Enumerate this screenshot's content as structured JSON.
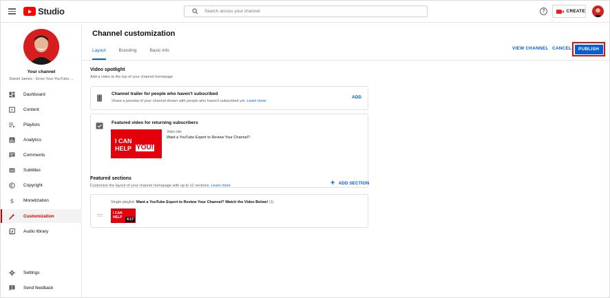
{
  "app": {
    "logo_text": "Studio"
  },
  "search": {
    "placeholder": "Search across your channel"
  },
  "header": {
    "help": "?",
    "create_label": "CREATE"
  },
  "sidebar": {
    "your_channel": "Your channel",
    "channel_name": "Daniel James - Grow Your YouTube ...",
    "items": [
      {
        "label": "Dashboard",
        "icon": "dashboard-icon"
      },
      {
        "label": "Content",
        "icon": "content-icon"
      },
      {
        "label": "Playlists",
        "icon": "playlists-icon"
      },
      {
        "label": "Analytics",
        "icon": "analytics-icon"
      },
      {
        "label": "Comments",
        "icon": "comments-icon"
      },
      {
        "label": "Subtitles",
        "icon": "subtitles-icon"
      },
      {
        "label": "Copyright",
        "icon": "copyright-icon"
      },
      {
        "label": "Monetization",
        "icon": "monetization-icon"
      },
      {
        "label": "Customization",
        "icon": "customization-icon",
        "active": true
      },
      {
        "label": "Audio library",
        "icon": "audio-library-icon"
      }
    ],
    "bottom_items": [
      {
        "label": "Settings",
        "icon": "settings-icon"
      },
      {
        "label": "Send feedback",
        "icon": "feedback-icon"
      }
    ]
  },
  "main": {
    "title": "Channel customization",
    "tabs": [
      {
        "label": "Layout",
        "active": true
      },
      {
        "label": "Branding"
      },
      {
        "label": "Basic info"
      }
    ],
    "view_channel": "VIEW CHANNEL",
    "cancel": "CANCEL",
    "publish": "PUBLISH"
  },
  "video_spotlight": {
    "title": "Video spotlight",
    "subtitle": "Add a video to the top of your channel homepage",
    "trailer": {
      "title": "Channel trailer for people who haven't subscribed",
      "subtitle": "Share a preview of your channel shown with people who haven't subscribed yet.",
      "learn_more": "Learn more",
      "add": "ADD"
    },
    "featured": {
      "title": "Featured video for returning subscribers",
      "video_title_label": "Video title",
      "video_title": "Want a YouTube Expert to Review Your Channel?",
      "thumb_line1": "I CAN",
      "thumb_line2": "HELP",
      "thumb_you": "YOU!"
    }
  },
  "featured_sections": {
    "title": "Featured sections",
    "subtitle": "Customize the layout of your channel homepage with up to 12 sections.",
    "learn_more": "Learn more",
    "add_section": "ADD SECTION",
    "item": {
      "type": "Single playlist:",
      "title": "Want a YouTube Expert to Review Your Channel? Watch the Video Below!",
      "count": "(1)",
      "thumb_line1": "I CAN",
      "thumb_line2": "HELP",
      "duration": "4:17"
    }
  },
  "colors": {
    "accent": "#065fd4",
    "brand_red": "#ff0000",
    "active_red": "#cc0000",
    "publish_outline": "#d01111"
  }
}
